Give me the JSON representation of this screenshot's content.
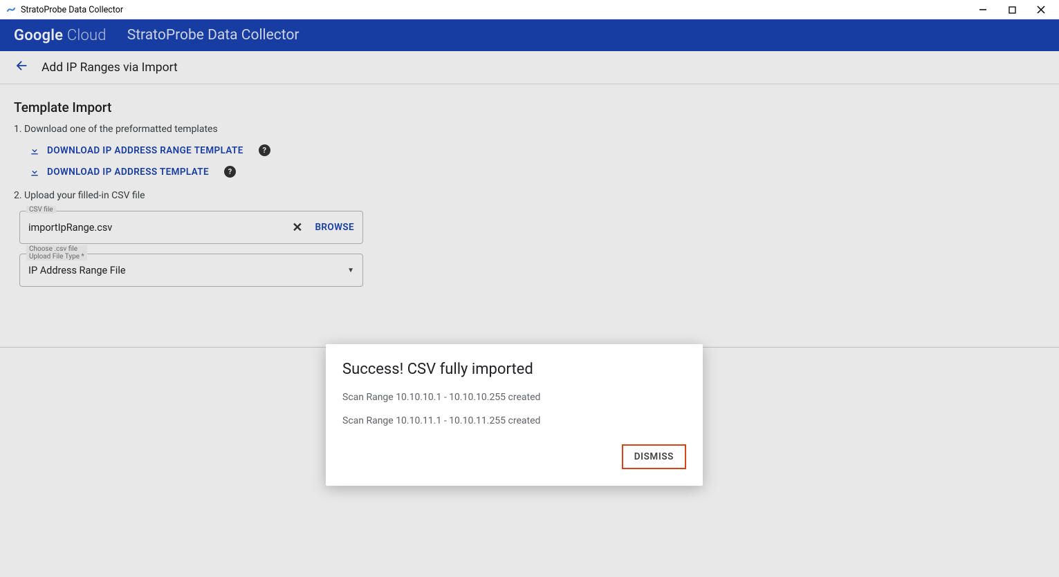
{
  "window": {
    "title": "StratoProbe Data Collector"
  },
  "brand": {
    "google": "Google",
    "cloud": "Cloud",
    "product": "StratoProbe Data Collector"
  },
  "subheader": {
    "title": "Add IP Ranges via Import"
  },
  "content": {
    "heading": "Template Import",
    "step1": "1. Download one of the preformatted templates",
    "download_range": "DOWNLOAD IP ADDRESS RANGE TEMPLATE",
    "download_addr": "DOWNLOAD IP ADDRESS TEMPLATE",
    "step2": "2. Upload your filled-in CSV file",
    "csv_label": "CSV file",
    "csv_value": "importIpRange.csv",
    "browse": "BROWSE",
    "type_label_line1": "Choose .csv file",
    "type_label_line2": "Upload File Type *",
    "type_value": "IP Address Range File"
  },
  "modal": {
    "title": "Success! CSV fully imported",
    "lines": [
      "Scan Range 10.10.10.1 - 10.10.10.255 created",
      "Scan Range 10.10.11.1 - 10.10.11.255 created"
    ],
    "dismiss": "DISMISS"
  }
}
